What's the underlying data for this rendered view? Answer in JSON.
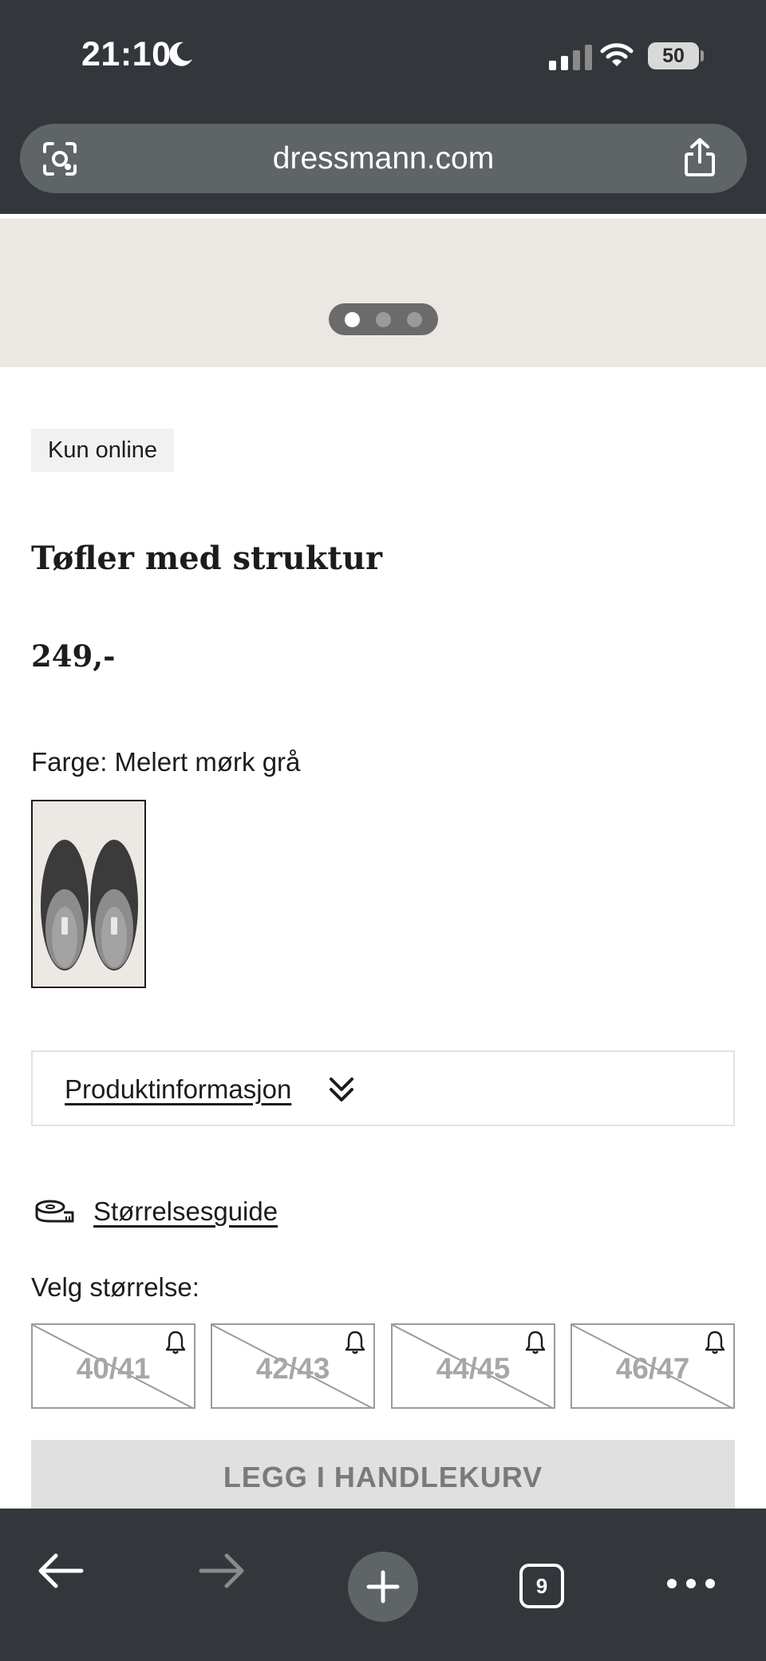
{
  "status_bar": {
    "time": "21:10",
    "battery": "50",
    "icons": [
      "moon-icon",
      "cellular-signal-icon",
      "wifi-icon",
      "battery-icon"
    ]
  },
  "browser": {
    "url": "dressmann.com",
    "icons": [
      "camera-search-icon",
      "share-icon"
    ]
  },
  "carousel": {
    "slide_count": 3,
    "active_index": 0
  },
  "product": {
    "badge": "Kun online",
    "title": "Tøfler med struktur",
    "price": "249,-",
    "color_label": "Farge: Melert mørk grå",
    "info_label": "Produktinformasjon",
    "size_guide_label": "Størrelsesguide",
    "size_label": "Velg størrelse:",
    "sizes": [
      {
        "label": "40/41",
        "available": false
      },
      {
        "label": "42/43",
        "available": false
      },
      {
        "label": "44/45",
        "available": false
      },
      {
        "label": "46/47",
        "available": false
      }
    ],
    "cart_button": "LEGG I HANDLEKURV"
  },
  "toolbar": {
    "tab_count": "9",
    "icons": [
      "back-arrow-icon",
      "forward-arrow-icon",
      "new-tab-plus-icon",
      "tabs-icon",
      "more-icon"
    ]
  },
  "colors": {
    "chrome_dark": "#33363a",
    "url_pill": "#5f6467",
    "image_bg": "#ebe8e4",
    "text": "#1c1c1c",
    "disabled_text": "#a7a7a7",
    "cart_bg": "#e0e0e0"
  }
}
